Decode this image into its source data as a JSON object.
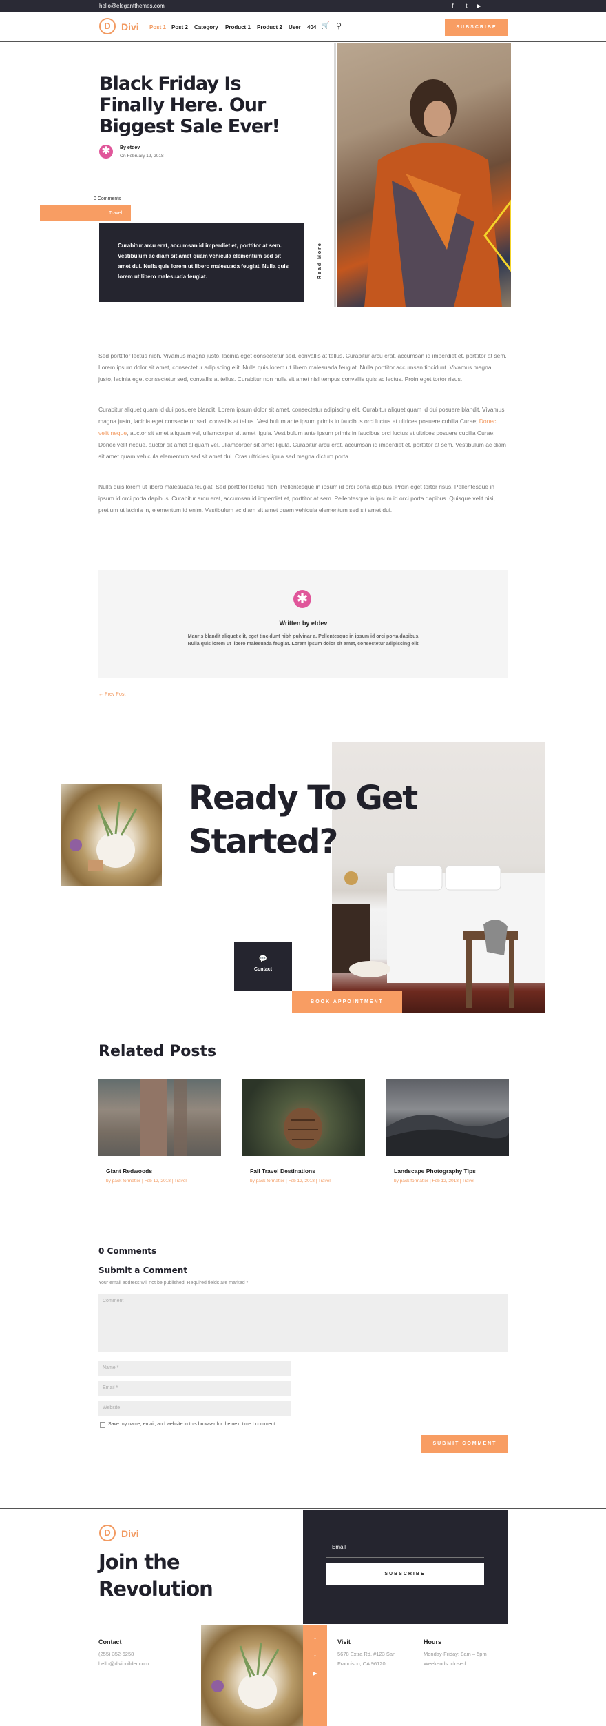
{
  "topbar": {
    "email": "hello@elegantthemes.com",
    "social": [
      "f",
      "t",
      "▶"
    ]
  },
  "nav": {
    "logo_letter": "D",
    "logo_text": "Divi",
    "items": [
      "Post 1",
      "Post 2",
      "Category",
      "Product 1",
      "Product 2",
      "User",
      "404"
    ],
    "subscribe": "Subscribe"
  },
  "hero": {
    "title": "Black Friday Is Finally Here. Our Biggest Sale Ever!",
    "author": "By etdev",
    "date": "On February 12, 2018",
    "comments": "0 Comments",
    "category": "Travel",
    "excerpt": "Curabitur arcu erat, accumsan id imperdiet et, porttitor at sem. Vestibulum ac diam sit amet quam vehicula elementum sed sit amet dui. Nulla quis lorem ut libero malesuada feugiat. Nulla quis lorem ut libero malesuada feugiat.",
    "read_more": "Read More"
  },
  "body": {
    "p1": "Sed porttitor lectus nibh. Vivamus magna justo, lacinia eget consectetur sed, convallis at tellus. Curabitur arcu erat, accumsan id imperdiet et, porttitor at sem. Lorem ipsum dolor sit amet, consectetur adipiscing elit. Nulla quis lorem ut libero malesuada feugiat. Nulla porttitor accumsan tincidunt. Vivamus magna justo, lacinia eget consectetur sed, convallis at tellus. Curabitur non nulla sit amet nisl tempus convallis quis ac lectus. Proin eget tortor risus.",
    "p2a": "Curabitur aliquet quam id dui posuere blandit. Lorem ipsum dolor sit amet, consectetur adipiscing elit. Curabitur aliquet quam id dui posuere blandit. Vivamus magna justo, lacinia eget consectetur sed, convallis at tellus. Vestibulum ante ipsum primis in faucibus orci luctus et ultrices posuere cubilia Curae; ",
    "p2link": "Donec velit neque",
    "p2b": ", auctor sit amet aliquam vel, ullamcorper sit amet ligula. Vestibulum ante ipsum primis in faucibus orci luctus et ultrices posuere cubilia Curae; Donec velit neque, auctor sit amet aliquam vel, ullamcorper sit amet ligula. Curabitur arcu erat, accumsan id imperdiet et, porttitor at sem. Vestibulum ac diam sit amet quam vehicula elementum sed sit amet dui. Cras ultricies ligula sed magna dictum porta.",
    "p3": "Nulla quis lorem ut libero malesuada feugiat. Sed porttitor lectus nibh. Pellentesque in ipsum id orci porta dapibus. Proin eget tortor risus. Pellentesque in ipsum id orci porta dapibus. Curabitur arcu erat, accumsan id imperdiet et, porttitor at sem. Pellentesque in ipsum id orci porta dapibus. Quisque velit nisi, pretium ut lacinia in, elementum id enim. Vestibulum ac diam sit amet quam vehicula elementum sed sit amet dui."
  },
  "author_box": {
    "name": "Written by etdev",
    "bio": "Mauris blandit aliquet elit, eget tincidunt nibh pulvinar a. Pellentesque in ipsum id orci porta dapibus. Nulla quis lorem ut libero malesuada feugiat. Lorem ipsum dolor sit amet, consectetur adipiscing elit."
  },
  "prev_post": "← Prev Post",
  "cta": {
    "title": "Ready To Get Started?",
    "contact": "Contact",
    "book": "Book Appointment"
  },
  "related": {
    "heading": "Related Posts",
    "posts": [
      {
        "title": "Giant Redwoods",
        "meta": "by pack formatter | Feb 12, 2018 | Travel"
      },
      {
        "title": "Fall Travel Destinations",
        "meta": "by pack formatter | Feb 12, 2018 | Travel"
      },
      {
        "title": "Landscape Photography Tips",
        "meta": "by pack formatter | Feb 12, 2018 | Travel"
      }
    ]
  },
  "comments": {
    "count": "0 Comments",
    "submit_heading": "Submit a Comment",
    "note": "Your email address will not be published. Required fields are marked *",
    "comment_placeholder": "Comment",
    "name_placeholder": "Name *",
    "email_placeholder": "Email *",
    "website_placeholder": "Website",
    "save_label": "Save my name, email, and website in this browser for the next time I comment.",
    "submit": "Submit Comment"
  },
  "footer": {
    "logo_letter": "D",
    "logo_text": "Divi",
    "join": "Join the Revolution",
    "email_label": "Email",
    "subscribe": "Subscribe",
    "contact_head": "Contact",
    "phone": "(255) 352-6258",
    "mail": "hello@divibuilder.com",
    "visit_head": "Visit",
    "address": "5678 Extra Rd. #123 San Francisco, CA 96120",
    "hours_head": "Hours",
    "hours": "Monday-Friday: 8am – 5pm",
    "weekends": "Weekends: closed",
    "social": [
      "f",
      "t",
      "▶"
    ]
  }
}
